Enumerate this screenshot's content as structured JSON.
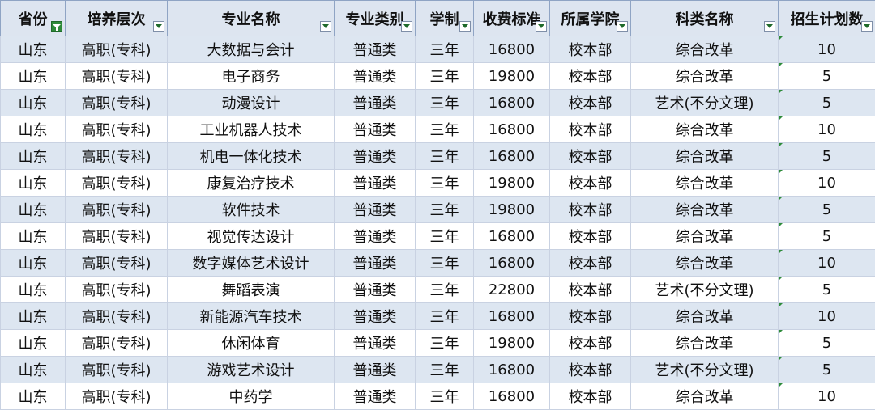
{
  "headers": [
    "省份",
    "培养层次",
    "专业名称",
    "专业类别",
    "学制",
    "收费标准",
    "所属学院",
    "科类名称",
    "招生计划数"
  ],
  "filter_icons": [
    "filter-active-icon",
    "dropdown-arrow-icon"
  ],
  "rows": [
    [
      "山东",
      "高职(专科)",
      "大数据与会计",
      "普通类",
      "三年",
      "16800",
      "校本部",
      "综合改革",
      "10"
    ],
    [
      "山东",
      "高职(专科)",
      "电子商务",
      "普通类",
      "三年",
      "19800",
      "校本部",
      "综合改革",
      "5"
    ],
    [
      "山东",
      "高职(专科)",
      "动漫设计",
      "普通类",
      "三年",
      "16800",
      "校本部",
      "艺术(不分文理)",
      "5"
    ],
    [
      "山东",
      "高职(专科)",
      "工业机器人技术",
      "普通类",
      "三年",
      "16800",
      "校本部",
      "综合改革",
      "10"
    ],
    [
      "山东",
      "高职(专科)",
      "机电一体化技术",
      "普通类",
      "三年",
      "16800",
      "校本部",
      "综合改革",
      "5"
    ],
    [
      "山东",
      "高职(专科)",
      "康复治疗技术",
      "普通类",
      "三年",
      "19800",
      "校本部",
      "综合改革",
      "10"
    ],
    [
      "山东",
      "高职(专科)",
      "软件技术",
      "普通类",
      "三年",
      "19800",
      "校本部",
      "综合改革",
      "5"
    ],
    [
      "山东",
      "高职(专科)",
      "视觉传达设计",
      "普通类",
      "三年",
      "16800",
      "校本部",
      "综合改革",
      "5"
    ],
    [
      "山东",
      "高职(专科)",
      "数字媒体艺术设计",
      "普通类",
      "三年",
      "16800",
      "校本部",
      "综合改革",
      "10"
    ],
    [
      "山东",
      "高职(专科)",
      "舞蹈表演",
      "普通类",
      "三年",
      "22800",
      "校本部",
      "艺术(不分文理)",
      "5"
    ],
    [
      "山东",
      "高职(专科)",
      "新能源汽车技术",
      "普通类",
      "三年",
      "16800",
      "校本部",
      "综合改革",
      "10"
    ],
    [
      "山东",
      "高职(专科)",
      "休闲体育",
      "普通类",
      "三年",
      "19800",
      "校本部",
      "综合改革",
      "5"
    ],
    [
      "山东",
      "高职(专科)",
      "游戏艺术设计",
      "普通类",
      "三年",
      "16800",
      "校本部",
      "艺术(不分文理)",
      "5"
    ],
    [
      "山东",
      "高职(专科)",
      "中药学",
      "普通类",
      "三年",
      "16800",
      "校本部",
      "综合改革",
      "10"
    ]
  ],
  "colors": {
    "header_bg": "#dde5f0",
    "row_band": "#dde6f1",
    "filter_active": "#2e8b3a"
  }
}
